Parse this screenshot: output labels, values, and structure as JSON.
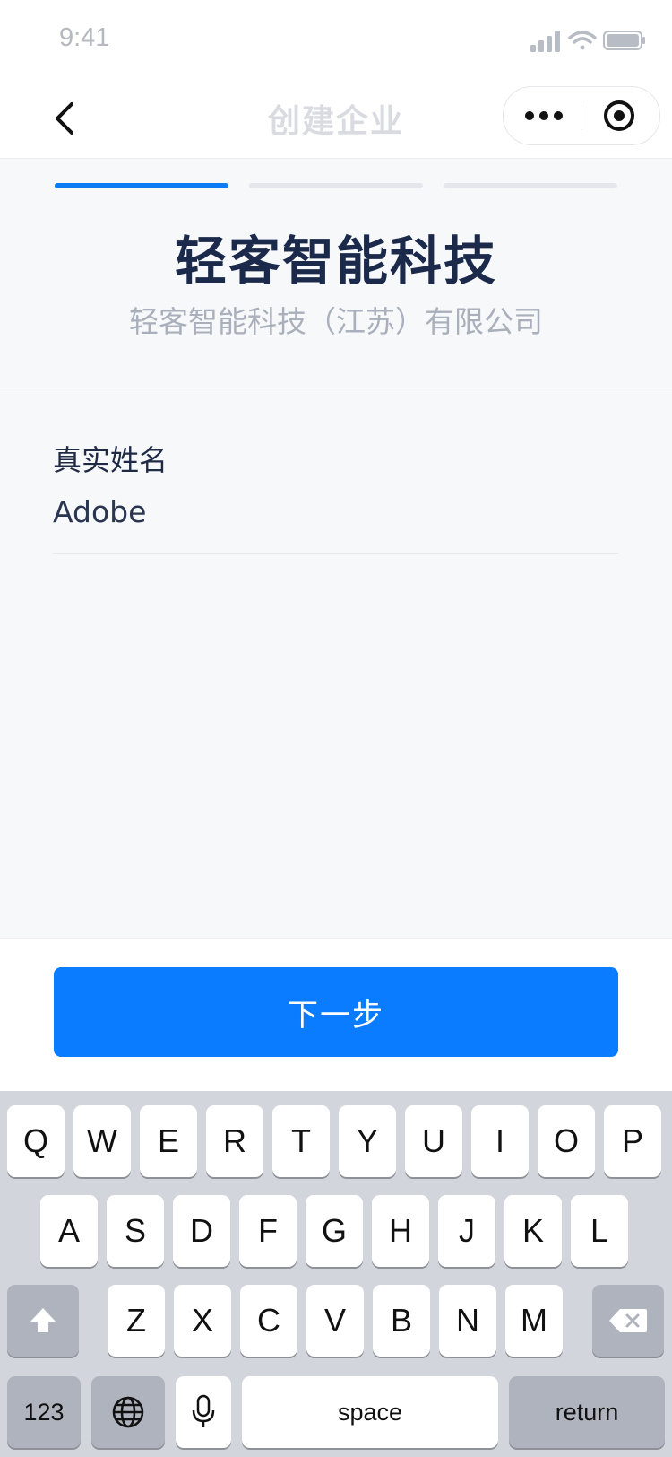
{
  "status_bar": {
    "time": "9:41"
  },
  "navbar": {
    "title": "创建企业"
  },
  "steps": {
    "total": 3,
    "current": 1
  },
  "company": {
    "name": "轻客智能科技",
    "full_name": "轻客智能科技（江苏）有限公司"
  },
  "form": {
    "label": "真实姓名",
    "value": "Adobe"
  },
  "actions": {
    "next_label": "下一步"
  },
  "colors": {
    "accent": "#0a7cff",
    "title": "#1b2a4a"
  },
  "keyboard": {
    "row1": [
      "Q",
      "W",
      "E",
      "R",
      "T",
      "Y",
      "U",
      "I",
      "O",
      "P"
    ],
    "row2": [
      "A",
      "S",
      "D",
      "F",
      "G",
      "H",
      "J",
      "K",
      "L"
    ],
    "row3": [
      "Z",
      "X",
      "C",
      "V",
      "B",
      "N",
      "M"
    ],
    "numbers_label": "123",
    "space_label": "space",
    "return_label": "return"
  }
}
